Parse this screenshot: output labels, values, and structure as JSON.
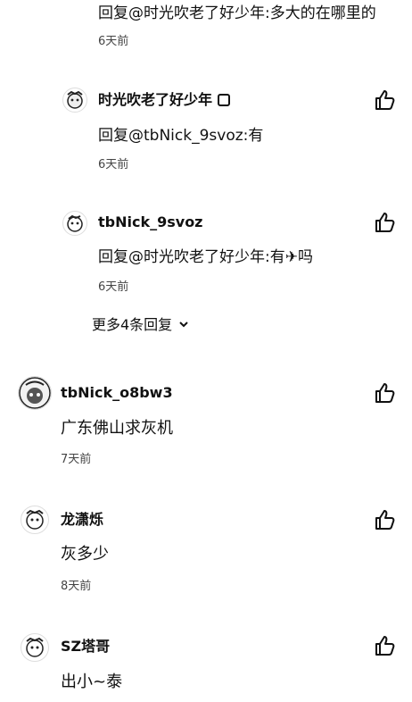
{
  "replies": [
    {
      "text": "回复@时光吹老了好少年:多大的在哪里的",
      "time": "6天前"
    },
    {
      "username": "时光吹老了好少年",
      "text": "回复@tbNick_9svoz:有",
      "time": "6天前"
    },
    {
      "username": "tbNick_9svoz",
      "text": "回复@时光吹老了好少年:有✈吗",
      "time": "6天前"
    }
  ],
  "more_replies_label": "更多4条回复",
  "comments": [
    {
      "username": "tbNick_o8bw3",
      "text": "广东佛山求灰机",
      "time": "7天前"
    },
    {
      "username": "龙潇烁",
      "text": "灰多少",
      "time": "8天前"
    },
    {
      "username": "SZ塔哥",
      "text": "出小~泰"
    }
  ],
  "icons": {
    "like": "thumbs-up-icon",
    "expand": "chevron-down-icon"
  }
}
